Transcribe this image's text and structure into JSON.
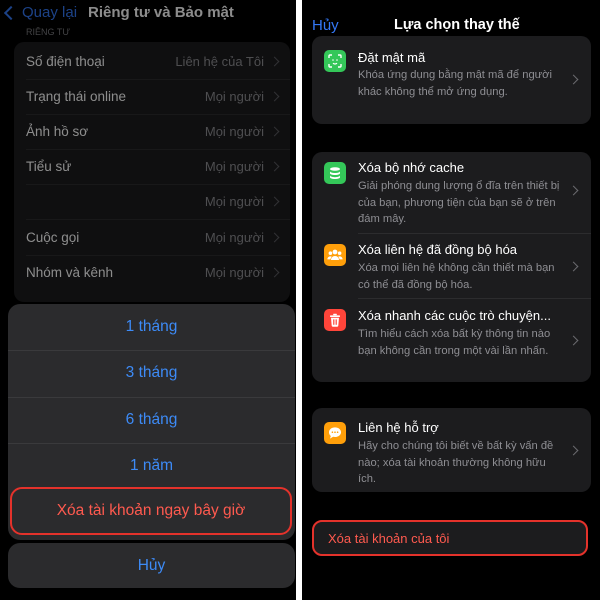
{
  "left": {
    "nav": {
      "back_label": "Quay lại",
      "title": "Riêng tư và Bảo mật"
    },
    "section_header": "RIÊNG TƯ",
    "rows": [
      {
        "label": "Số điện thoại",
        "value": "Liên hệ của Tôi"
      },
      {
        "label": "Trạng thái online",
        "value": "Mọi người"
      },
      {
        "label": "Ảnh hồ sơ",
        "value": "Mọi người"
      },
      {
        "label": "Tiểu sử",
        "value": "Mọi người"
      },
      {
        "label": "",
        "value": "Mọi người"
      },
      {
        "label": "Cuộc gọi",
        "value": "Mọi người"
      },
      {
        "label": "Nhóm và kênh",
        "value": "Mọi người"
      }
    ],
    "sheet": {
      "options": [
        "1 tháng",
        "3 tháng",
        "6 tháng",
        "1 năm"
      ],
      "delete_now": "Xóa tài khoản ngay bây giờ",
      "cancel": "Hủy"
    }
  },
  "right": {
    "nav": {
      "cancel_label": "Hủy",
      "title": "Lựa chọn thay thế"
    },
    "groups": [
      {
        "items": [
          {
            "title": "Đặt mật mã",
            "desc": "Khóa ứng dụng bằng mật mã để người khác không thể mở ứng dụng.",
            "icon": "face-lock-icon",
            "color": "#34c759"
          }
        ]
      },
      {
        "items": [
          {
            "title": "Xóa bộ nhớ cache",
            "desc": "Giải phóng dung lượng ổ đĩa trên thiết bị của bạn, phương tiện của bạn sẽ ở trên đám mây.",
            "icon": "database-icon",
            "color": "#34c759"
          },
          {
            "title": "Xóa liên hệ đã đồng bộ hóa",
            "desc": "Xóa mọi liên hệ không cần thiết mà bạn có thể đã đồng bộ hóa.",
            "icon": "contacts-icon",
            "color": "#ff9f0a"
          },
          {
            "title": "Xóa nhanh các cuộc trò chuyện...",
            "desc": "Tìm hiểu cách xóa bất kỳ thông tin nào bạn không cần trong một vài lần nhấn.",
            "icon": "trash-icon",
            "color": "#ff453a"
          }
        ]
      },
      {
        "items": [
          {
            "title": "Liên hệ hỗ trợ",
            "desc": "Hãy cho chúng tôi biết về bất kỳ vấn đề nào; xóa tài khoản thường không hữu ích.",
            "icon": "chat-bubble-icon",
            "color": "#ff9f0a"
          }
        ]
      }
    ],
    "delete_account": "Xóa tài khoản của tôi"
  }
}
